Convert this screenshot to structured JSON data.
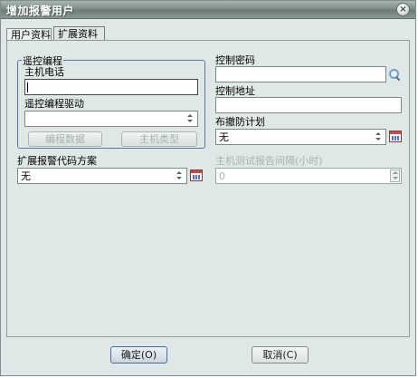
{
  "window": {
    "title": "增加报警用户",
    "close_glyph": "×"
  },
  "tabs": [
    {
      "label": "用户资料",
      "active": false
    },
    {
      "label": "扩展资料",
      "active": true
    }
  ],
  "remote_group": {
    "legend": "遥控编程",
    "host_phone_label": "主机电话",
    "host_phone_value": "",
    "driver_label": "遥控编程驱动",
    "driver_value": "",
    "program_data_button": "编程数据",
    "host_type_button": "主机类型"
  },
  "alarm_code": {
    "label": "扩展报警代码方案",
    "value": "无"
  },
  "control_password": {
    "label": "控制密码",
    "value": ""
  },
  "control_address": {
    "label": "控制地址",
    "value": ""
  },
  "arm_plan": {
    "label": "布撤防计划",
    "value": "无"
  },
  "host_test_interval": {
    "label": "主机测试报告间隔(小时)",
    "value": "0"
  },
  "footer": {
    "ok_button": "确定(O)",
    "cancel_button": "取消(C)"
  },
  "icons": {
    "calendar": "calendar-icon",
    "search": "search-icon",
    "close": "close-icon",
    "spinner": "spinner-arrows-icon"
  },
  "colors": {
    "title_bar": "#7f8d89",
    "dialog_bg": "#dfe8e7",
    "group_border": "#5a76b0",
    "disabled_text": "#a6b2b0"
  }
}
